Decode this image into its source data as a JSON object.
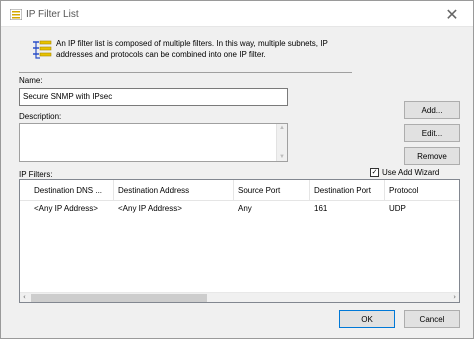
{
  "window": {
    "title": "IP Filter List",
    "close_glyph": "✕"
  },
  "intro_text": "An IP filter list is composed of multiple filters. In this way, multiple subnets, IP addresses and protocols can be combined into one IP filter.",
  "icons": {
    "title": "filter-list-icon",
    "header": "filter-list-icon",
    "close": "close-icon",
    "scroll_up": "chevron-up-icon",
    "scroll_down": "chevron-down-icon",
    "scroll_left": "chevron-left-icon",
    "scroll_right": "chevron-right-icon"
  },
  "name": {
    "label": "Name:",
    "value": "Secure SNMP with IPsec"
  },
  "description": {
    "label": "Description:",
    "value": ""
  },
  "buttons": {
    "add": "Add...",
    "edit": "Edit...",
    "remove": "Remove",
    "ok": "OK",
    "cancel": "Cancel"
  },
  "filters": {
    "label": "IP Filters:",
    "use_add_wizard": {
      "label": "Use Add Wizard",
      "checked": true,
      "glyph": "✓"
    },
    "columns": [
      "Destination DNS ...",
      "Destination Address",
      "Source Port",
      "Destination Port",
      "Protocol"
    ],
    "rows": [
      [
        "<Any IP Address>",
        "<Any IP Address>",
        "Any",
        "161",
        "UDP"
      ]
    ]
  },
  "colors": {
    "dialog_bg": "#f0f0f0",
    "button_bg": "#e1e1e1",
    "default_button_border": "#0078d7"
  }
}
